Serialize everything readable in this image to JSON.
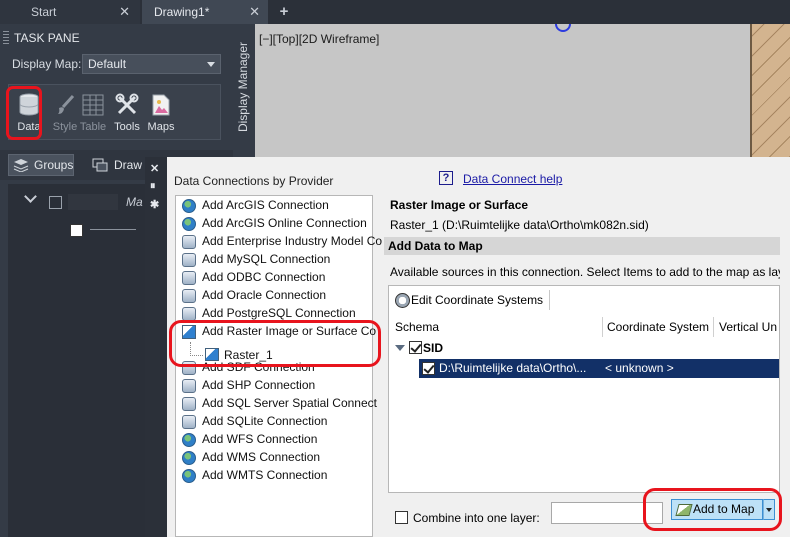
{
  "tabs": {
    "start": "Start",
    "drawing": "Drawing1*",
    "close_glyph": "✕",
    "new_tab_glyph": "+"
  },
  "task_pane": {
    "title": "TASK PANE",
    "display_map_label": "Display Map:",
    "display_map_value": "Default",
    "tools": [
      {
        "label": "Data",
        "icon": "database-icon"
      },
      {
        "label": "Style",
        "icon": "brush-icon"
      },
      {
        "label": "Table",
        "icon": "table-icon"
      },
      {
        "label": "Tools",
        "icon": "tools-icon"
      },
      {
        "label": "Maps",
        "icon": "maps-icon"
      }
    ],
    "groups_label": "Groups",
    "draw_label": "Draw",
    "layer_italic": "Ma"
  },
  "display_manager_tab": "Display Manager",
  "viewport": {
    "label": "[−][Top][2D Wireframe]"
  },
  "dialog": {
    "providers_title": "Data Connections by Provider",
    "help_icon": "?",
    "help_link": "Data Connect help",
    "providers": [
      {
        "label": "Add ArcGIS Connection",
        "icon": "globe-icon"
      },
      {
        "label": "Add ArcGIS Online Connection",
        "icon": "globe-icon"
      },
      {
        "label": "Add Enterprise Industry Model Co",
        "icon": "database-icon"
      },
      {
        "label": "Add MySQL Connection",
        "icon": "database-icon"
      },
      {
        "label": "Add ODBC Connection",
        "icon": "database-icon"
      },
      {
        "label": "Add Oracle Connection",
        "icon": "database-icon"
      },
      {
        "label": "Add PostgreSQL Connection",
        "icon": "database-icon"
      },
      {
        "label": "Add Raster Image or Surface Co",
        "icon": "raster-icon"
      },
      {
        "label": "Add SDF Connection",
        "icon": "database-icon"
      },
      {
        "label": "Add SHP Connection",
        "icon": "database-icon"
      },
      {
        "label": "Add SQL Server Spatial Connect",
        "icon": "database-icon"
      },
      {
        "label": "Add SQLite Connection",
        "icon": "database-icon"
      },
      {
        "label": "Add WFS Connection",
        "icon": "globe-icon"
      },
      {
        "label": "Add WMS Connection",
        "icon": "globe-icon"
      },
      {
        "label": "Add WMTS Connection",
        "icon": "globe-icon"
      }
    ],
    "raster_child": "Raster_1",
    "right_title": "Raster Image or Surface",
    "right_path": "Raster_1 (D:\\Ruimtelijke data\\Ortho\\mk082n.sid)",
    "add_data_header": "Add Data to Map",
    "available_text": "Available sources in this connection.  Select Items to add to the map as lay",
    "edit_cs": "Edit Coordinate Systems",
    "columns": [
      "Schema",
      "Coordinate System",
      "Vertical Un"
    ],
    "schema_group": "SID",
    "selected_row": {
      "source": "D:\\Ruimtelijke data\\Ortho\\...",
      "coord": "< unknown >"
    },
    "combine_label": "Combine into one layer:",
    "add_to_map": "Add to Map"
  },
  "highlight_color": "#e8141d",
  "selection_color": "#123067"
}
